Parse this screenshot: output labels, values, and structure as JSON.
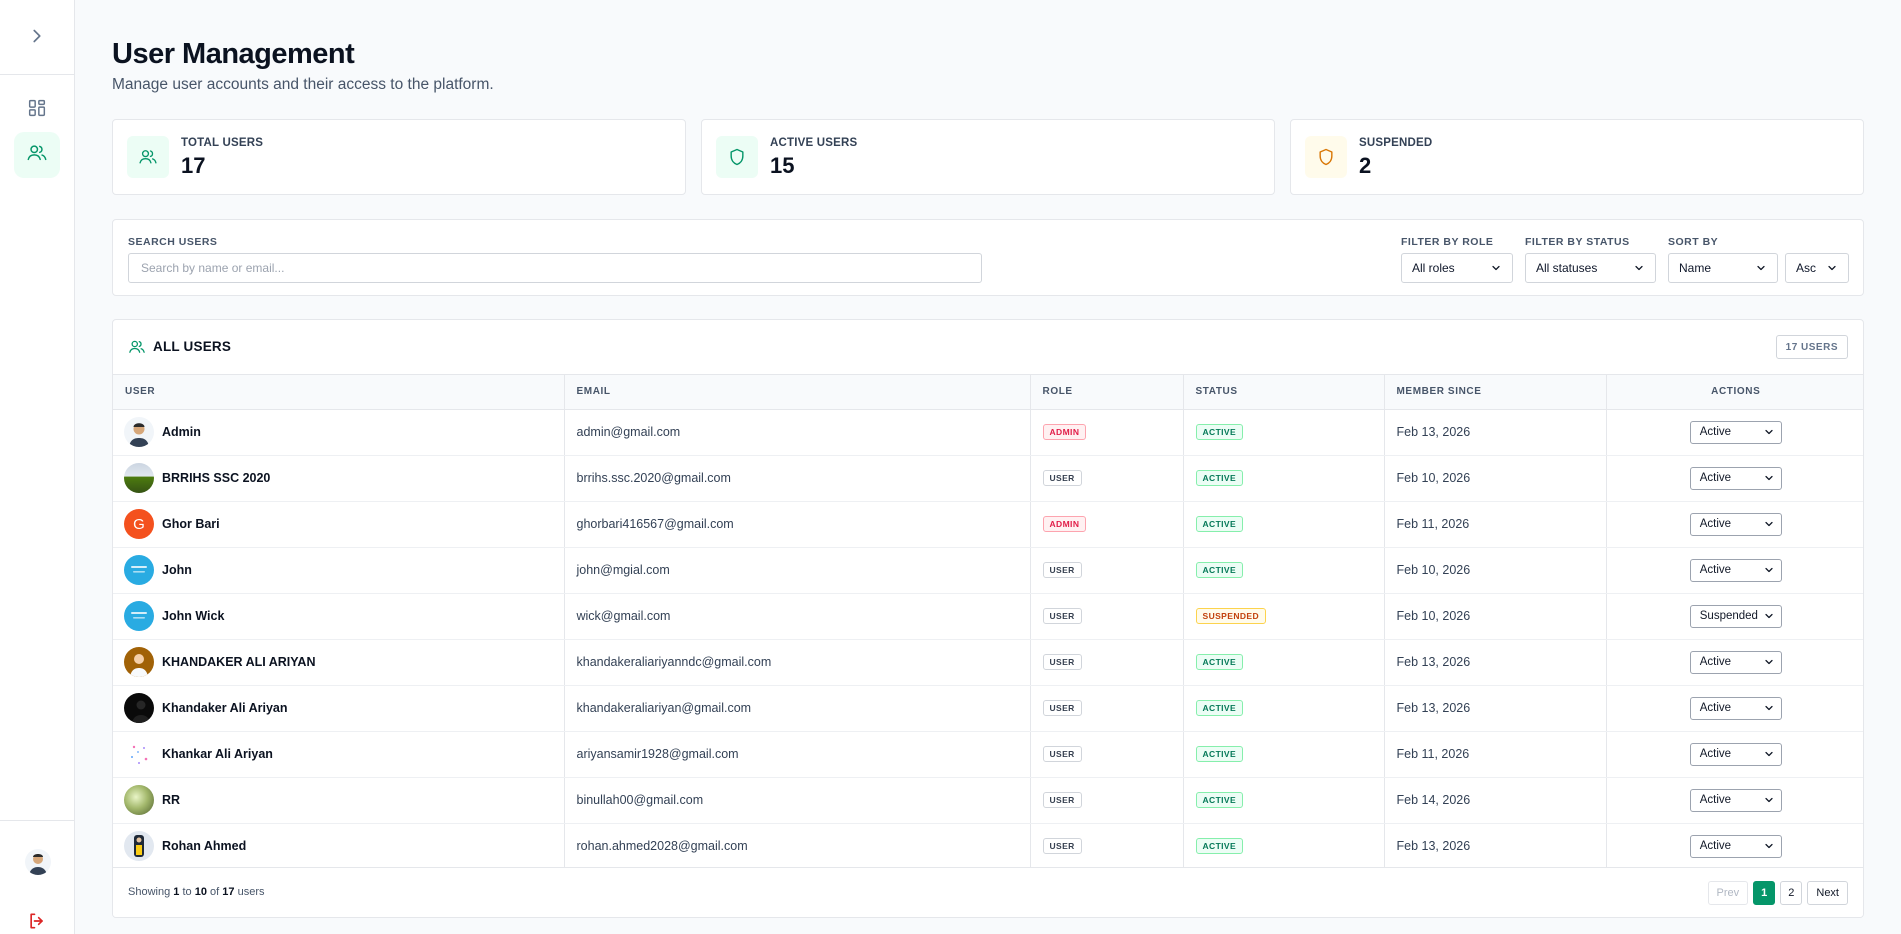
{
  "header": {
    "title": "User Management",
    "subtitle": "Manage user accounts and their access to the platform."
  },
  "stats": [
    {
      "label": "TOTAL USERS",
      "value": "17",
      "icon": "users-icon",
      "color": "#059669"
    },
    {
      "label": "ACTIVE USERS",
      "value": "15",
      "icon": "shield-icon",
      "color": "#059669"
    },
    {
      "label": "SUSPENDED",
      "value": "2",
      "icon": "shield-icon",
      "color": "#d97706"
    }
  ],
  "filters": {
    "search_label": "SEARCH USERS",
    "search_placeholder": "Search by name or email...",
    "role_label": "FILTER BY ROLE",
    "role_value": "All roles",
    "status_label": "FILTER BY STATUS",
    "status_value": "All statuses",
    "sort_label": "SORT BY",
    "sort_value": "Name",
    "order_value": "Asc"
  },
  "users_table": {
    "title": "ALL USERS",
    "count_badge": "17 USERS",
    "columns": [
      "USER",
      "EMAIL",
      "ROLE",
      "STATUS",
      "MEMBER SINCE",
      "ACTIONS"
    ],
    "rows": [
      {
        "name": "Admin",
        "email": "admin@gmail.com",
        "role": "ADMIN",
        "status": "ACTIVE",
        "since": "Feb 13, 2026",
        "action": "Active"
      },
      {
        "name": "BRRIHS SSC 2020",
        "email": "brrihs.ssc.2020@gmail.com",
        "role": "USER",
        "status": "ACTIVE",
        "since": "Feb 10, 2026",
        "action": "Active"
      },
      {
        "name": "Ghor Bari",
        "email": "ghorbari416567@gmail.com",
        "role": "ADMIN",
        "status": "ACTIVE",
        "since": "Feb 11, 2026",
        "action": "Active",
        "initial": "G"
      },
      {
        "name": "John",
        "email": "john@mgial.com",
        "role": "USER",
        "status": "ACTIVE",
        "since": "Feb 10, 2026",
        "action": "Active"
      },
      {
        "name": "John Wick",
        "email": "wick@gmail.com",
        "role": "USER",
        "status": "SUSPENDED",
        "since": "Feb 10, 2026",
        "action": "Suspended"
      },
      {
        "name": "KHANDAKER ALI ARIYAN",
        "email": "khandakeraliariyanndc@gmail.com",
        "role": "USER",
        "status": "ACTIVE",
        "since": "Feb 13, 2026",
        "action": "Active"
      },
      {
        "name": "Khandaker Ali Ariyan",
        "email": "khandakeraliariyan@gmail.com",
        "role": "USER",
        "status": "ACTIVE",
        "since": "Feb 13, 2026",
        "action": "Active"
      },
      {
        "name": "Khankar Ali Ariyan",
        "email": "ariyansamir1928@gmail.com",
        "role": "USER",
        "status": "ACTIVE",
        "since": "Feb 11, 2026",
        "action": "Active"
      },
      {
        "name": "RR",
        "email": "binullah00@gmail.com",
        "role": "USER",
        "status": "ACTIVE",
        "since": "Feb 14, 2026",
        "action": "Active"
      },
      {
        "name": "Rohan Ahmed",
        "email": "rohan.ahmed2028@gmail.com",
        "role": "USER",
        "status": "ACTIVE",
        "since": "Feb 13, 2026",
        "action": "Active"
      }
    ]
  },
  "pagination": {
    "showing_prefix": "Showing",
    "from": "1",
    "to_word": "to",
    "to": "10",
    "of_word": "of",
    "total": "17",
    "suffix": "users",
    "prev": "Prev",
    "pages": [
      "1",
      "2"
    ],
    "next": "Next"
  },
  "colors": {
    "accent": "#059669",
    "admin": "#e11d48",
    "suspended": "#c2410c"
  }
}
